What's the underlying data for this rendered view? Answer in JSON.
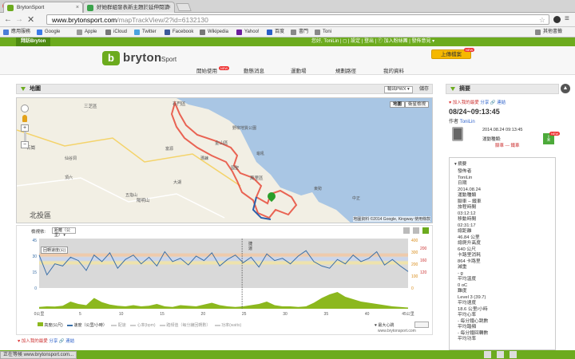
{
  "browser": {
    "tabs": [
      {
        "title": "BrytonSport",
        "favicon_color": "#6cab1e"
      },
      {
        "title": "好她群組發表新主題於延伸閱讀",
        "favicon_color": "#3aa34b"
      }
    ],
    "url_host": "www.brytonsport.com",
    "url_path": "/mapTrackView/2?id=6132130",
    "bookmarks": [
      {
        "label": "應用服務",
        "color": "#4a7dd6"
      },
      {
        "label": "Google",
        "color": "#3b7be8"
      },
      {
        "label": "Apple",
        "color": "#999999"
      },
      {
        "label": "iCloud",
        "color": "#777777"
      },
      {
        "label": "Twitter",
        "color": "#4aa3df"
      },
      {
        "label": "Facebook",
        "color": "#3b5998"
      },
      {
        "label": "Wikipedia",
        "color": "#777777"
      },
      {
        "label": "Yahoo!",
        "color": "#6b1d9b"
      },
      {
        "label": "百度",
        "color": "#2a5fc9"
      },
      {
        "label": "書門",
        "color": "#888888"
      },
      {
        "label": "Toni",
        "color": "#888888"
      }
    ],
    "other_bookmarks": "其他書籤",
    "status_url": "正在等候 www.brytonsport.com..."
  },
  "site": {
    "brand_tab": "拜訪Bryton",
    "top_links": "您好, ToniLin | ◻ | 設定 | 登出 | ⓕ 加入粉絲團 | 發佈意見 ▾",
    "logo_letter": "b",
    "logo_text": "bryton",
    "logo_sport": "Sport",
    "nav": [
      {
        "label": "開始使用",
        "new": "NEW"
      },
      {
        "label": "動態消息",
        "new": ""
      },
      {
        "label": "運動場",
        "new": ""
      },
      {
        "label": "規劃路徑",
        "new": ""
      },
      {
        "label": "我的資料",
        "new": ""
      }
    ],
    "upload_button": "上傳檔案",
    "upload_badge": "NEW",
    "accent": "#6cab1e"
  },
  "map_panel": {
    "title": "地圖",
    "export_select": "輸出PWX",
    "save": "儲存",
    "map_tab": "地圖",
    "satellite_tab": "衛星檢視",
    "place_labels": [
      "三芝區",
      "石門區",
      "金山區",
      "萬里區",
      "野柳地質公園",
      "石崗",
      "陽明山",
      "龜吼",
      "瑪鍊",
      "國聖",
      "富源",
      "五指山",
      "大湖",
      "頂六",
      "東勢",
      "中正",
      "北投區",
      "仙谷洞"
    ],
    "attribution": "地圖資料 ©2014 Google, Kingway  使用條款"
  },
  "chart_controls": {
    "x_label": "檢視依:",
    "x_select": "距離（公里）",
    "legend": [
      "高度(公尺)",
      "速度（公里/小時）",
      "配速",
      "心率(bpm)",
      "踏頻值（每分鐘回轉數）",
      "功率(watts)"
    ],
    "max_time": "最大心跳",
    "watermark": "www.brytonsport.com",
    "tooltip": "回轉速度(公)",
    "marker": "捷\n運"
  },
  "chart_data": {
    "type": "area",
    "x_range": [
      0,
      47
    ],
    "x_ticks": [
      "0公里",
      "5",
      "10",
      "15",
      "20",
      "25",
      "30",
      "35",
      "40",
      "45公里"
    ],
    "left_ticks": [
      "45",
      "30",
      "15",
      "0"
    ],
    "right_ticks_power": [
      "400",
      "300",
      "200",
      "100",
      "0"
    ],
    "right_ticks_hr": [
      "200",
      "160",
      "120"
    ],
    "series": [
      {
        "name": "高度(公尺)",
        "color": "#8cb81e",
        "values": [
          15,
          20,
          18,
          25,
          60,
          40,
          30,
          90,
          55,
          35,
          25,
          20,
          30,
          20,
          25,
          40,
          20,
          15,
          30,
          25,
          20,
          35,
          50,
          30,
          20,
          15,
          20,
          30,
          40,
          60,
          30,
          20,
          20,
          15,
          20,
          50,
          90,
          120,
          140,
          100,
          80,
          60,
          50,
          40,
          30,
          20,
          15,
          10
        ]
      },
      {
        "name": "速度（公里/小時）",
        "color": "#3a6fa8",
        "values": [
          30,
          12,
          22,
          20,
          28,
          25,
          16,
          30,
          24,
          32,
          18,
          26,
          30,
          22,
          28,
          20,
          33,
          24,
          27,
          21,
          29,
          25,
          32,
          20,
          26,
          30,
          23,
          28,
          19,
          31,
          25,
          27,
          22,
          29,
          34,
          24,
          20,
          18,
          26,
          22,
          30,
          24,
          27,
          33,
          21,
          26,
          20,
          15
        ]
      }
    ]
  },
  "bottom_share": {
    "share_text": "加入我的最愛",
    "share_link": "分享",
    "link_text": "連結"
  },
  "summary": {
    "title": "摘要",
    "fav": "加入我的最愛",
    "share": "分享",
    "link": "連結",
    "datetime": "08/24~09:13:45",
    "author_label": "作者",
    "author": "ToniLin",
    "record_date": "2014.08.24 09:13:45",
    "sport_type_label": "運動種類:",
    "sport_type": "腳車 — 鐵車",
    "details_title": "摘要",
    "details": [
      "發佈者",
      "ToniLin",
      "日期",
      "2014.08.24",
      "運動種類",
      "腳車 – 鐵車",
      "旅程時間",
      "03:12:12",
      "移動時間",
      "02:31:17",
      "總距離",
      "46.84 公里",
      "總爬升高度",
      "640 公尺",
      "卡路里消耗",
      "864 卡路里",
      "減重",
      "- g",
      "平均溫度",
      "0 oC",
      "難度",
      "Level 3 (39.7)",
      "平均速度",
      "18.6 公里/小時",
      "平均心率",
      "- 每分鐘心跳數",
      "平均踏頻",
      "- 每分鐘回轉數",
      "平均功率"
    ],
    "badge": "NEW"
  }
}
